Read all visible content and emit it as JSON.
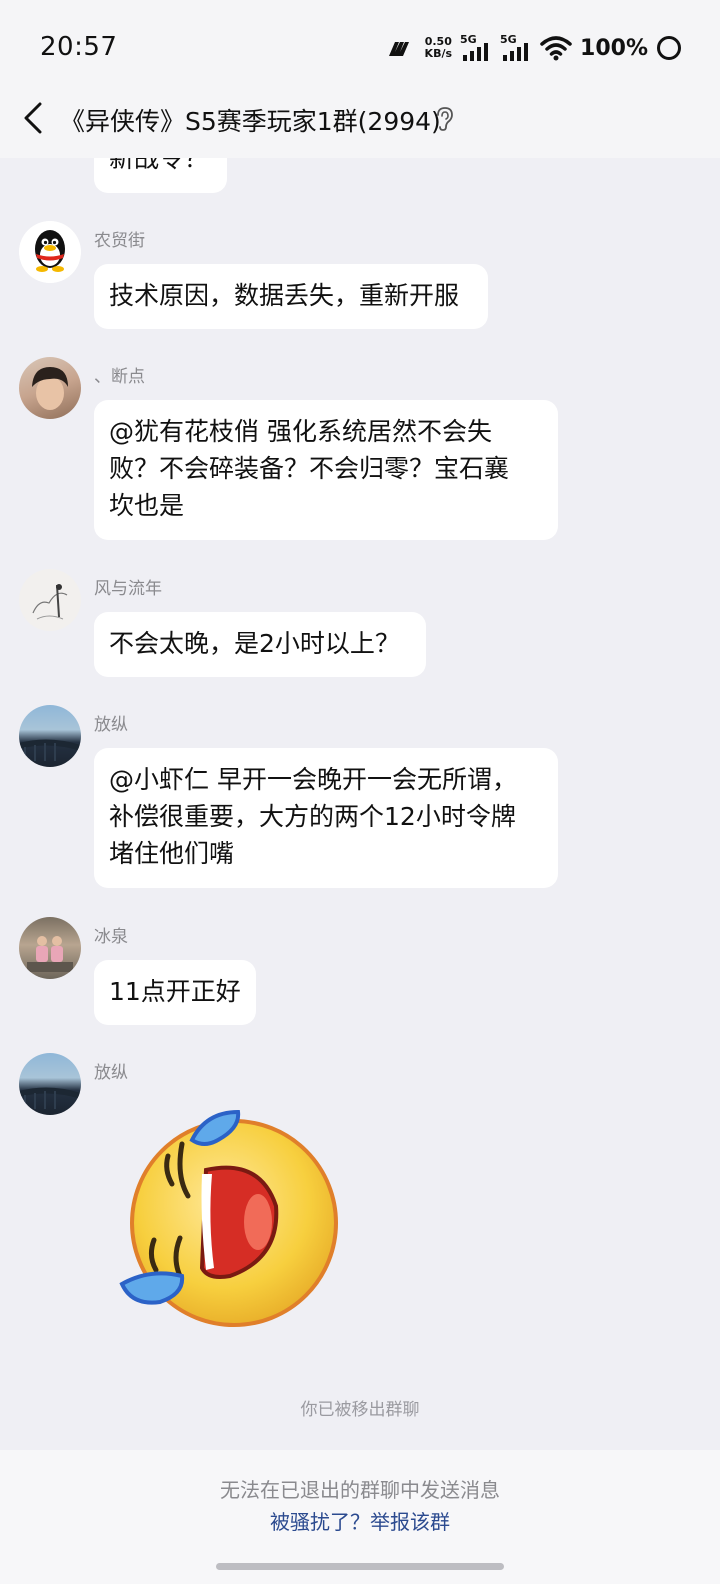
{
  "status_bar": {
    "time": "20:57",
    "net_speed_value": "0.50",
    "net_speed_unit": "KB/s",
    "signal1_label": "5G",
    "signal2_label": "5G",
    "battery": "100%"
  },
  "header": {
    "title": "《异侠传》S5赛季玩家1群(2994)"
  },
  "messages": [
    {
      "sender": "",
      "text": "新战令？"
    },
    {
      "sender": "农贸街",
      "text": "技术原因，数据丢失，重新开服"
    },
    {
      "sender": "、断点",
      "lines": [
        "@犹有花枝俏 强化系统居然不会失",
        "败？不会碎装备？不会归零？宝石襄",
        "坎也是"
      ]
    },
    {
      "sender": "风与流年",
      "text": "不会太晚，是2小时以上？"
    },
    {
      "sender": "放纵",
      "lines": [
        "@小虾仁 早开一会晚开一会无所谓，",
        "补偿很重要，大方的两个12小时令牌",
        "堵住他们嘴"
      ]
    },
    {
      "sender": "冰泉",
      "text": "11点开正好"
    },
    {
      "sender": "放纵",
      "sticker": "laughing-tears-emoji"
    }
  ],
  "system_notice": "你已被移出群聊",
  "footer": {
    "info": "无法在已退出的群聊中发送消息",
    "report_link": "被骚扰了？举报该群"
  },
  "colors": {
    "background": "#efeff4",
    "bubble": "#ffffff",
    "link": "#2b4a8f",
    "meta_text": "#8a8a8e"
  }
}
